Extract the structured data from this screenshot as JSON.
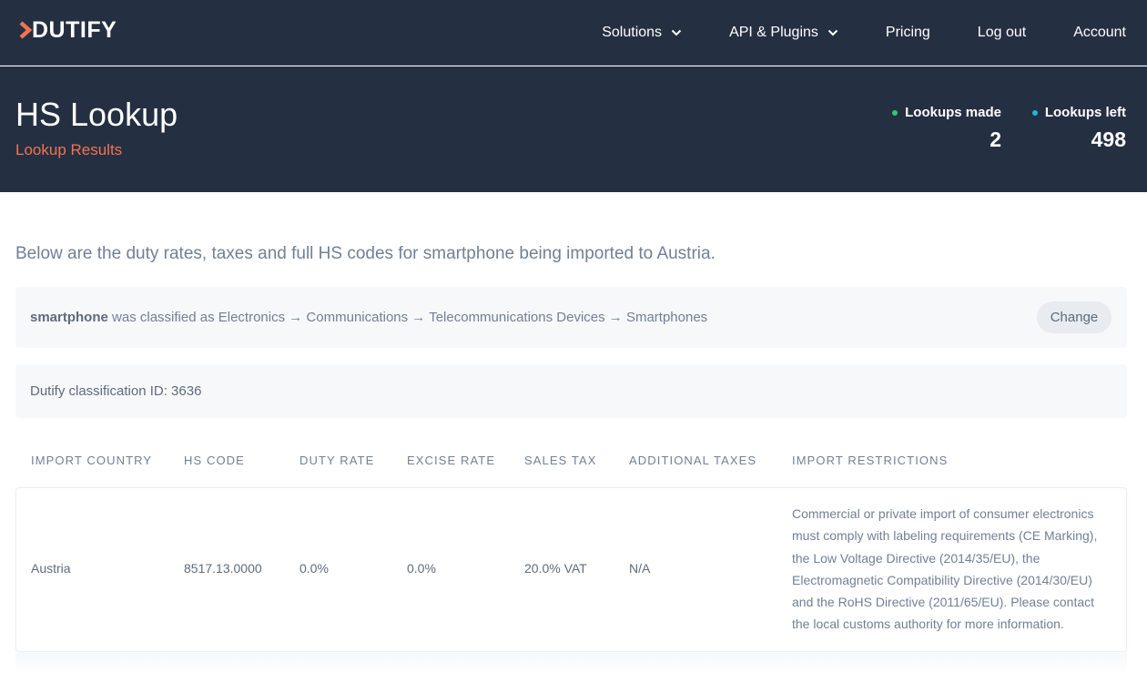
{
  "brand": {
    "name": "DUTIFY",
    "accent": "#f2734e"
  },
  "nav": {
    "solutions": "Solutions",
    "api": "API & Plugins",
    "pricing": "Pricing",
    "logout": "Log out",
    "account": "Account"
  },
  "header": {
    "title": "HS Lookup",
    "subtitle": "Lookup Results",
    "stats": [
      {
        "label": "Lookups made",
        "value": "2",
        "dot_color": "#2ecc71"
      },
      {
        "label": "Lookups left",
        "value": "498",
        "dot_color": "#1fb6d6"
      }
    ]
  },
  "main": {
    "intro": "Below are the duty rates, taxes and full HS codes for smartphone being imported to Austria.",
    "classification": {
      "product": "smartphone",
      "text": " was classified as Electronics → Communications → Telecommunications Devices → Smartphones",
      "change_label": "Change"
    },
    "classification_id": "Dutify classification ID: 3636",
    "table": {
      "headers": [
        "Import Country",
        "HS Code",
        "Duty Rate",
        "Excise Rate",
        "Sales Tax",
        "Additional Taxes",
        "Import Restrictions"
      ],
      "rows": [
        {
          "country": "Austria",
          "hs_code": "8517.13.0000",
          "duty_rate": "0.0%",
          "excise_rate": "0.0%",
          "sales_tax": "20.0% VAT",
          "additional_taxes": "N/A",
          "restrictions": "Commercial or private import of consumer electronics must comply with labeling requirements (CE Marking), the Low Voltage Directive (2014/35/EU), the Electromagnetic Compatibility Directive (2014/30/EU) and the RoHS Directive (2011/65/EU). Please contact the local customs authority for more information."
        }
      ]
    }
  },
  "icons": {
    "logo": "chevron-right-logo-icon",
    "dropdown": "chevron-down-icon"
  }
}
